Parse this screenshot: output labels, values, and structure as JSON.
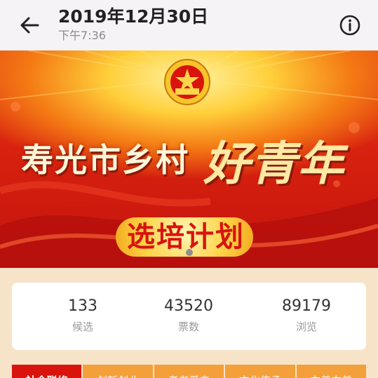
{
  "header": {
    "title": "2019年12月30日",
    "subtitle": "下午7:36",
    "back_icon": "arrow-left-icon",
    "info_icon": "info-circle-icon"
  },
  "banner": {
    "headline": "寿光市乡村",
    "headline_script": "好青年",
    "pill_text": "选培计划",
    "emblem_text": "中国共青团",
    "colors": {
      "primary_red": "#d8220f",
      "gold": "#ffd54a"
    }
  },
  "stats": [
    {
      "value": "133",
      "label": "候选"
    },
    {
      "value": "43520",
      "label": "票数"
    },
    {
      "value": "89179",
      "label": "浏览"
    }
  ],
  "tabs": [
    {
      "label": "社会联络"
    },
    {
      "label": "创新创业"
    },
    {
      "label": "孝老爱亲"
    },
    {
      "label": "文化传承"
    },
    {
      "label": "向善向美"
    }
  ]
}
